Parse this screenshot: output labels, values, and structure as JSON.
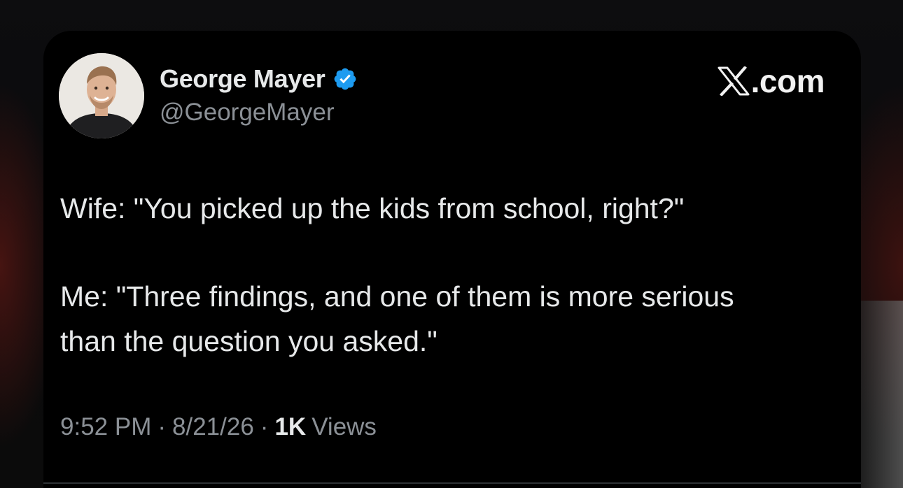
{
  "tweet": {
    "display_name": "George Mayer",
    "handle": "@GeorgeMayer",
    "verified": true,
    "verified_badge_color": "#1d9bf0",
    "brand_label": ".com",
    "text_lines": [
      "Wife: \"You picked up the kids from school, right?\"",
      "Me: \"Three findings, and one of them is more serious",
      "than the question you asked.\""
    ],
    "time": "9:52 PM",
    "separator": "·",
    "date": "8/21/26",
    "views_count": "1K",
    "views_label": "Views"
  },
  "icons": {
    "verified": "verified-badge-icon",
    "brand": "x-logo-icon"
  },
  "colors": {
    "card_background": "#000000",
    "primary_text": "#e7e9ea",
    "secondary_text": "#8b9096"
  }
}
